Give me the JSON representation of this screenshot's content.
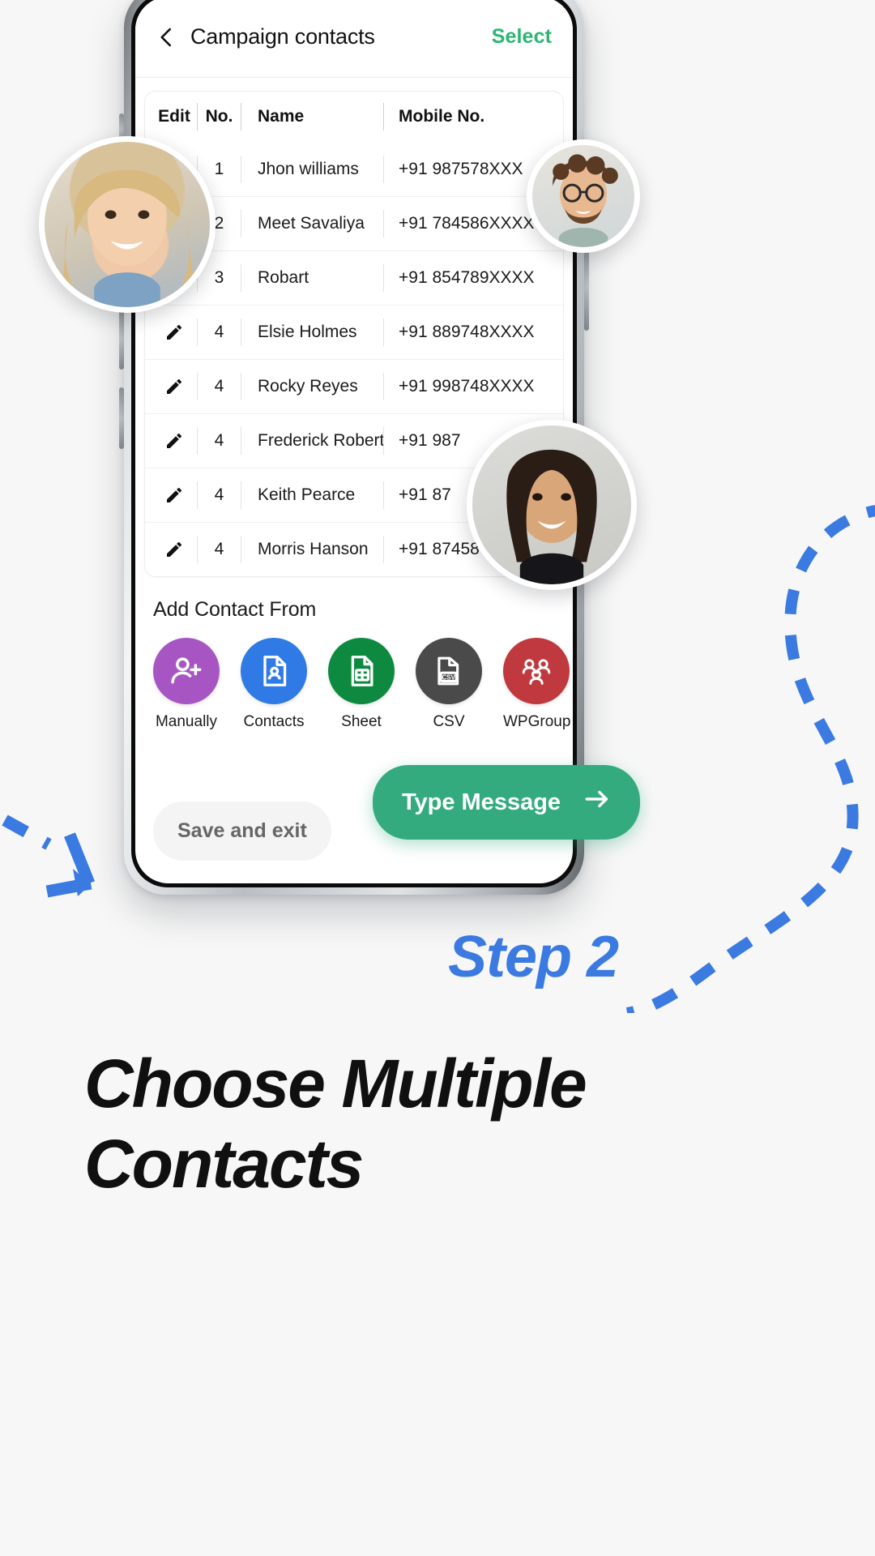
{
  "app": {
    "header": {
      "back_icon": "chevron-left-icon",
      "title": "Campaign contacts",
      "select_label": "Select"
    },
    "table": {
      "columns": [
        "Edit",
        "No.",
        "Name",
        "Mobile No."
      ],
      "rows": [
        {
          "edit": "",
          "no": "1",
          "name": "Jhon williams",
          "mobile": "+91 987578XXX"
        },
        {
          "edit": "",
          "no": "2",
          "name": "Meet Savaliya",
          "mobile": "+91 784586XXXX"
        },
        {
          "edit": "",
          "no": "3",
          "name": "Robart",
          "mobile": "+91 854789XXXX"
        },
        {
          "edit": "pencil-icon",
          "no": "4",
          "name": "Elsie Holmes",
          "mobile": "+91 889748XXXX"
        },
        {
          "edit": "pencil-icon",
          "no": "4",
          "name": "Rocky Reyes",
          "mobile": "+91 998748XXXX"
        },
        {
          "edit": "pencil-icon",
          "no": "4",
          "name": "Frederick Robertson",
          "mobile": "+91 987"
        },
        {
          "edit": "pencil-icon",
          "no": "4",
          "name": "Keith Pearce",
          "mobile": "+91 87"
        },
        {
          "edit": "pencil-icon",
          "no": "4",
          "name": "Morris Hanson",
          "mobile": "+91 874587"
        }
      ]
    },
    "add_contact": {
      "title": "Add Contact From",
      "options": [
        {
          "label": "Manually",
          "icon": "person-add-icon",
          "color": "#a855c4"
        },
        {
          "label": "Contacts",
          "icon": "contact-card-icon",
          "color": "#2f7ae5"
        },
        {
          "label": "Sheet",
          "icon": "spreadsheet-icon",
          "color": "#0d8a40"
        },
        {
          "label": "CSV",
          "icon": "csv-file-icon",
          "color": "#4a4a4a"
        },
        {
          "label": "WPGroup",
          "icon": "group-people-icon",
          "color": "#c0393f"
        }
      ]
    },
    "footer": {
      "save_label": "Save and exit",
      "type_message_label": "Type Message",
      "type_message_icon": "arrow-right-icon"
    }
  },
  "promo": {
    "step_label": "Step 2",
    "headline_line1": "Choose Multiple",
    "headline_line2": "Contacts"
  },
  "colors": {
    "accent_green": "#33ab7f",
    "select_green": "#2bb673",
    "accent_blue": "#3b7ae0",
    "background": "#f7f7f7"
  }
}
